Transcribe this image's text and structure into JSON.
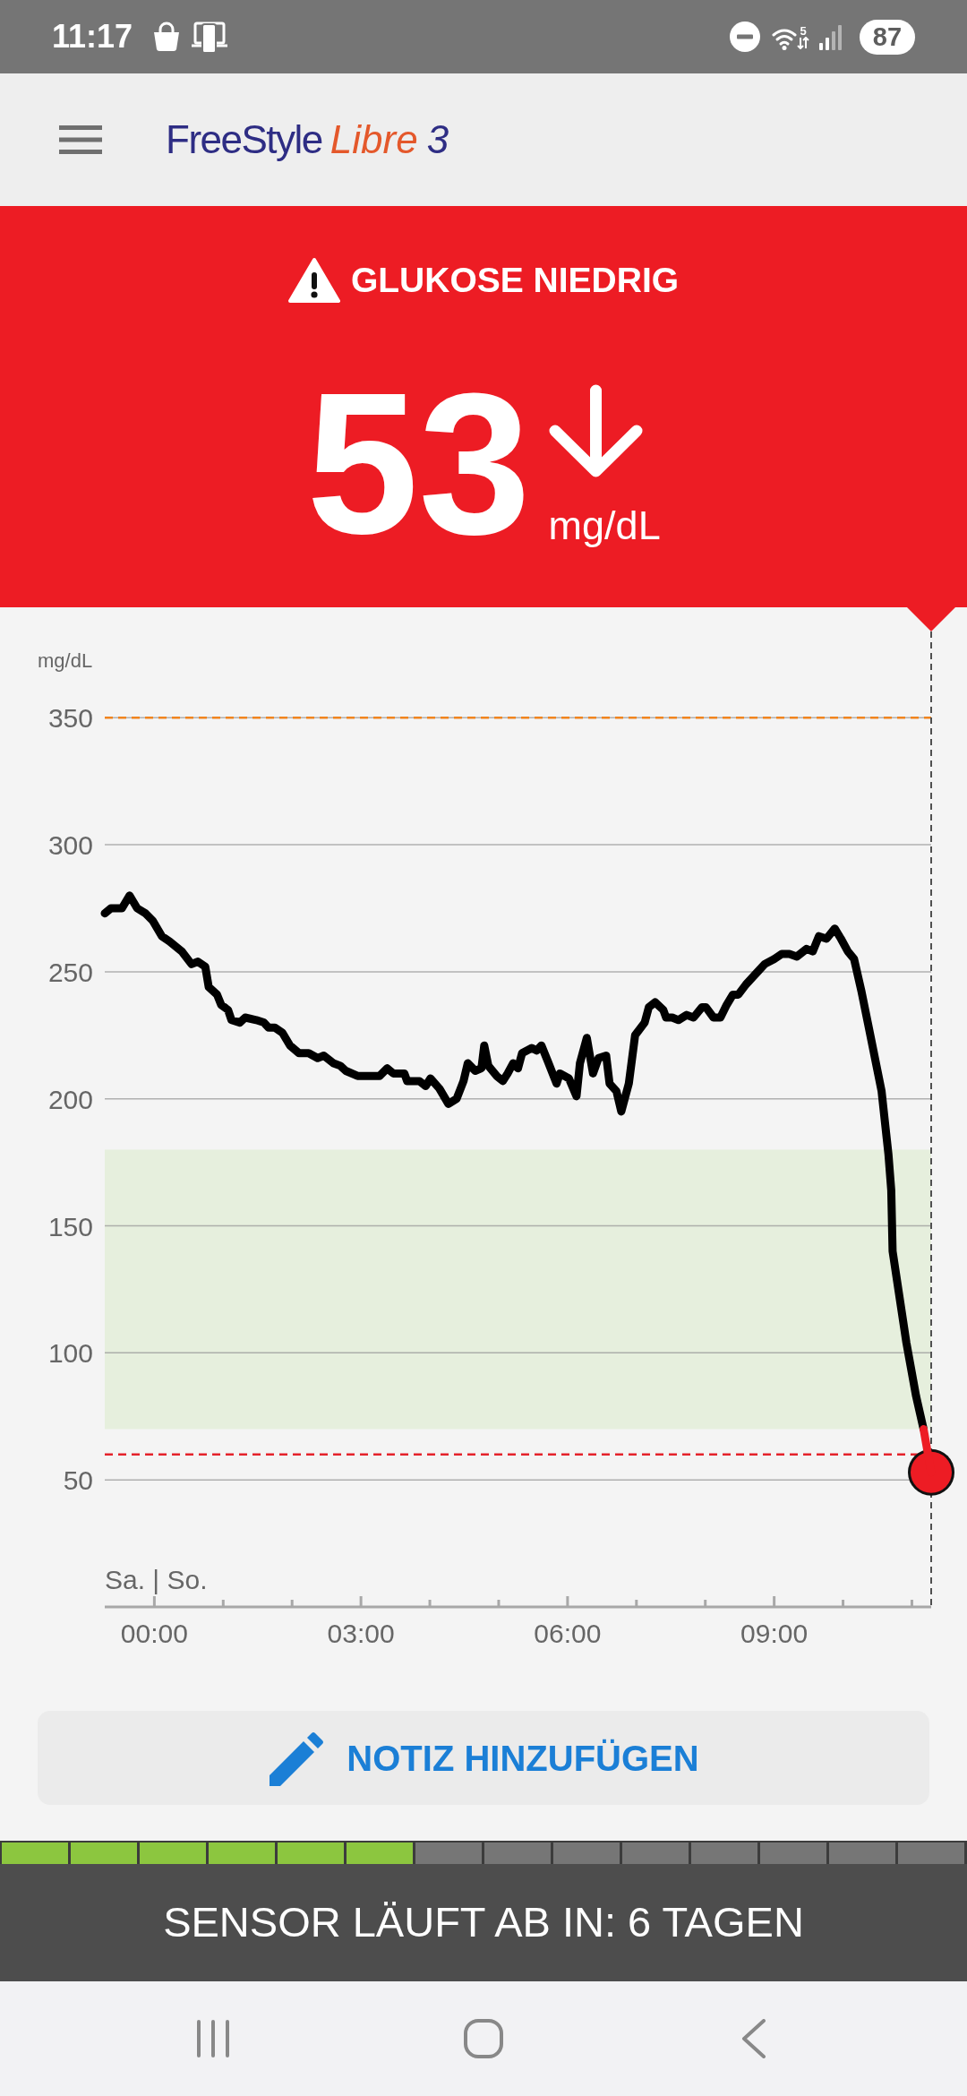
{
  "status_bar": {
    "time": "11:17",
    "wifi_label": "5",
    "battery": "87"
  },
  "header": {
    "logo": {
      "brand": "FreeStyle",
      "product": "Libre",
      "version": "3"
    }
  },
  "alert": {
    "title": "GLUKOSE NIEDRIG"
  },
  "reading": {
    "value": "53",
    "unit": "mg/dL"
  },
  "chart": {
    "chart_data": {
      "type": "line",
      "ylabel": "mg/dL",
      "xlabel": "Sa. | So.",
      "x": [
        -0.72,
        -0.63,
        -0.47,
        -0.36,
        -0.25,
        -0.13,
        -0.02,
        0.11,
        0.22,
        0.4,
        0.54,
        0.63,
        0.74,
        0.79,
        0.91,
        0.97,
        1.07,
        1.12,
        1.24,
        1.32,
        1.48,
        1.59,
        1.66,
        1.75,
        1.86,
        1.97,
        2.1,
        2.24,
        2.37,
        2.46,
        2.6,
        2.7,
        2.78,
        2.95,
        3.27,
        3.38,
        3.47,
        3.63,
        3.67,
        3.85,
        3.94,
        4.01,
        4.14,
        4.27,
        4.39,
        4.49,
        4.55,
        4.66,
        4.75,
        4.79,
        4.85,
        4.97,
        5.06,
        5.13,
        5.21,
        5.28,
        5.34,
        5.48,
        5.55,
        5.62,
        5.71,
        5.84,
        5.89,
        6.02,
        6.13,
        6.18,
        6.28,
        6.37,
        6.45,
        6.56,
        6.61,
        6.71,
        6.78,
        6.89,
        6.98,
        7.12,
        7.18,
        7.27,
        7.39,
        7.43,
        7.52,
        7.61,
        7.73,
        7.83,
        7.95,
        8.01,
        8.12,
        8.22,
        8.31,
        8.4,
        8.48,
        8.59,
        8.76,
        8.86,
        9,
        9.11,
        9.22,
        9.33,
        9.47,
        9.56,
        9.65,
        9.76,
        9.88,
        9.97,
        10.07,
        10.16,
        10.27,
        10.36,
        10.56,
        10.66,
        10.7,
        10.72,
        10.92,
        11.06,
        11.17,
        11.28
      ],
      "series": [
        {
          "color": "#000000",
          "values": [
            273,
            275,
            275,
            280,
            275,
            273,
            270,
            264,
            262,
            258,
            253,
            254,
            252,
            244,
            241,
            237,
            235,
            231,
            230,
            232,
            231,
            230,
            228,
            228,
            226,
            221,
            218,
            218,
            216,
            217,
            214,
            213,
            211,
            209,
            209,
            212,
            210,
            210,
            207,
            207,
            205,
            208,
            204,
            198,
            200,
            207,
            214,
            211,
            212,
            221,
            213,
            209,
            207,
            210,
            214,
            212,
            218,
            220,
            219,
            221,
            215,
            206,
            210,
            208,
            201,
            214,
            224,
            210,
            216,
            217,
            206,
            203,
            195,
            206,
            225,
            230,
            236,
            238,
            235,
            232,
            232,
            231,
            233,
            232,
            236,
            236,
            232,
            232,
            237,
            241,
            241,
            245,
            250,
            253,
            255,
            257,
            257,
            256,
            259,
            258,
            264,
            263,
            267,
            263,
            258,
            255,
            242,
            230,
            203,
            178,
            164,
            140,
            104,
            83,
            70,
            null
          ]
        },
        {
          "color": "#ed1c24",
          "values": [
            null,
            null,
            null,
            null,
            null,
            null,
            null,
            null,
            null,
            null,
            null,
            null,
            null,
            null,
            null,
            null,
            null,
            null,
            null,
            null,
            null,
            null,
            null,
            null,
            null,
            null,
            null,
            null,
            null,
            null,
            null,
            null,
            null,
            null,
            null,
            null,
            null,
            null,
            null,
            null,
            null,
            null,
            null,
            null,
            null,
            null,
            null,
            null,
            null,
            null,
            null,
            null,
            null,
            null,
            null,
            null,
            null,
            null,
            null,
            null,
            null,
            null,
            null,
            null,
            null,
            null,
            null,
            null,
            null,
            null,
            null,
            null,
            null,
            null,
            null,
            null,
            null,
            null,
            null,
            null,
            null,
            null,
            null,
            null,
            null,
            null,
            null,
            null,
            null,
            null,
            null,
            null,
            null,
            null,
            null,
            null,
            null,
            null,
            null,
            null,
            null,
            null,
            null,
            null,
            null,
            null,
            null,
            null,
            null,
            null,
            null,
            null,
            null,
            null,
            70,
            53
          ]
        }
      ],
      "xlim": [
        -0.72,
        11.28
      ],
      "ylim": [
        0,
        385
      ],
      "grid": true,
      "xticks": [
        {
          "value": 0,
          "label": "00:00"
        },
        {
          "value": 3,
          "label": "03:00"
        },
        {
          "value": 6,
          "label": "06:00"
        },
        {
          "value": 9,
          "label": "09:00"
        }
      ],
      "yticks": [
        50,
        100,
        150,
        200,
        250,
        300,
        350
      ],
      "bands": [
        {
          "axis": "y",
          "from": 70,
          "to": 180,
          "color": "#e6efdd"
        }
      ],
      "ref_lines": [
        {
          "axis": "y",
          "value": 350,
          "color": "#f0841e"
        },
        {
          "axis": "y",
          "value": 60,
          "color": "#e4222b"
        }
      ]
    }
  },
  "note_button": {
    "label": "NOTIZ HINZUFÜGEN"
  },
  "sensor": {
    "segments": [
      {
        "filled": true
      },
      {
        "filled": true
      },
      {
        "filled": true
      },
      {
        "filled": true
      },
      {
        "filled": true
      },
      {
        "filled": true
      },
      {
        "filled": false
      },
      {
        "filled": false
      },
      {
        "filled": false
      },
      {
        "filled": false
      },
      {
        "filled": false
      },
      {
        "filled": false
      },
      {
        "filled": false
      },
      {
        "filled": false
      }
    ],
    "text": "SENSOR LÄUFT AB IN: 6 TAGEN"
  }
}
